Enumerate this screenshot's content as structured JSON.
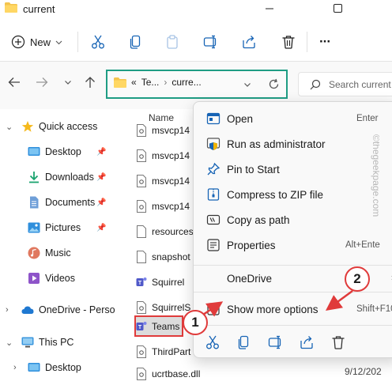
{
  "window": {
    "title": "current"
  },
  "toolbar": {
    "new_label": "New",
    "more_label": "···"
  },
  "address": {
    "prefix": "«",
    "crumbs": [
      "Te...",
      "curre..."
    ],
    "search_placeholder": "Search current"
  },
  "navpane": {
    "items": [
      {
        "label": "Quick access"
      },
      {
        "label": "Desktop"
      },
      {
        "label": "Downloads"
      },
      {
        "label": "Documents"
      },
      {
        "label": "Pictures"
      },
      {
        "label": "Music"
      },
      {
        "label": "Videos"
      },
      {
        "label": "OneDrive - Perso"
      },
      {
        "label": "This PC"
      },
      {
        "label": "Desktop"
      }
    ]
  },
  "files": {
    "column_name": "Name",
    "rows": [
      {
        "name": "msvcp14"
      },
      {
        "name": "msvcp14"
      },
      {
        "name": "msvcp14"
      },
      {
        "name": "msvcp14"
      },
      {
        "name": "resources"
      },
      {
        "name": "snapshot"
      },
      {
        "name": "Squirrel"
      },
      {
        "name": "SquirrelS"
      },
      {
        "name": "Teams"
      },
      {
        "name": "ThirdPart"
      },
      {
        "name": "ucrtbase.dll"
      }
    ],
    "date_partial": "9/12/202"
  },
  "context_menu": {
    "items": [
      {
        "label": "Open",
        "shortcut": "Enter"
      },
      {
        "label": "Run as administrator",
        "shortcut": ""
      },
      {
        "label": "Pin to Start",
        "shortcut": ""
      },
      {
        "label": "Compress to ZIP file",
        "shortcut": ""
      },
      {
        "label": "Copy as path",
        "shortcut": ""
      },
      {
        "label": "Properties",
        "shortcut": "Alt+Ente"
      },
      {
        "label": "OneDrive",
        "shortcut": ""
      },
      {
        "label": "Show more options",
        "shortcut": "Shift+F10"
      }
    ]
  },
  "callouts": {
    "one": "1",
    "two": "2"
  },
  "watermark": "©thegeekpage.com",
  "colors": {
    "accent": "#005fb8",
    "address_highlight": "#1f9d84",
    "callout_red": "#e03b3b",
    "folder_yellow": "#f4c44e"
  }
}
